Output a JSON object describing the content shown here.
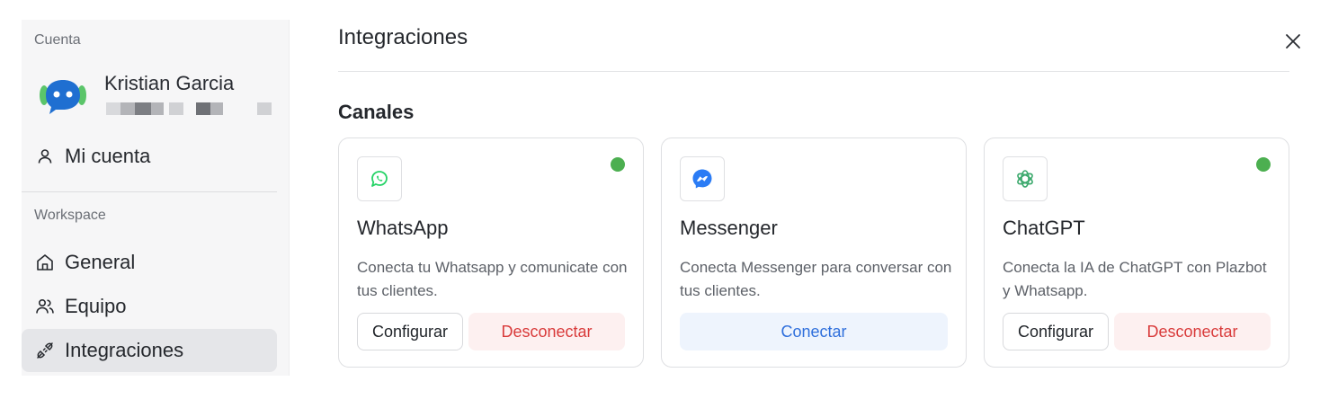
{
  "sidebar": {
    "account_label": "Cuenta",
    "user": {
      "name": "Kristian Garcia",
      "avatar_icon": "chat-bot-avatar-icon"
    },
    "account_items": [
      {
        "label": "Mi cuenta",
        "icon": "user-icon"
      }
    ],
    "workspace_label": "Workspace",
    "workspace_items": [
      {
        "label": "General",
        "icon": "home-icon"
      },
      {
        "label": "Equipo",
        "icon": "team-icon"
      },
      {
        "label": "Integraciones",
        "icon": "plug-icon",
        "active": true
      }
    ]
  },
  "main": {
    "title": "Integraciones",
    "close_icon": "close-icon",
    "section_title": "Canales",
    "cards": [
      {
        "name": "WhatsApp",
        "icon": "whatsapp-icon",
        "description": "Conecta tu Whatsapp y comunicate con tus clientes.",
        "connected": true,
        "buttons": {
          "configure": "Configurar",
          "disconnect": "Desconectar"
        }
      },
      {
        "name": "Messenger",
        "icon": "messenger-icon",
        "description": "Conecta Messenger para conversar con tus clientes.",
        "connected": false,
        "buttons": {
          "connect": "Conectar"
        }
      },
      {
        "name": "ChatGPT",
        "icon": "chatgpt-icon",
        "description": "Conecta la IA de ChatGPT con Plazbot y Whatsapp.",
        "connected": true,
        "buttons": {
          "configure": "Configurar",
          "disconnect": "Desconectar"
        }
      }
    ]
  },
  "colors": {
    "status_connected": "#4caf50",
    "danger_text": "#d93b3b",
    "danger_bg": "#fdf0f0",
    "primary_text": "#2f6fdc",
    "primary_bg": "#eef4fd",
    "whatsapp": "#25d366",
    "messenger": "#2b7cf5",
    "avatar": "#1f6fd1",
    "avatar_accent": "#5bc56a"
  }
}
